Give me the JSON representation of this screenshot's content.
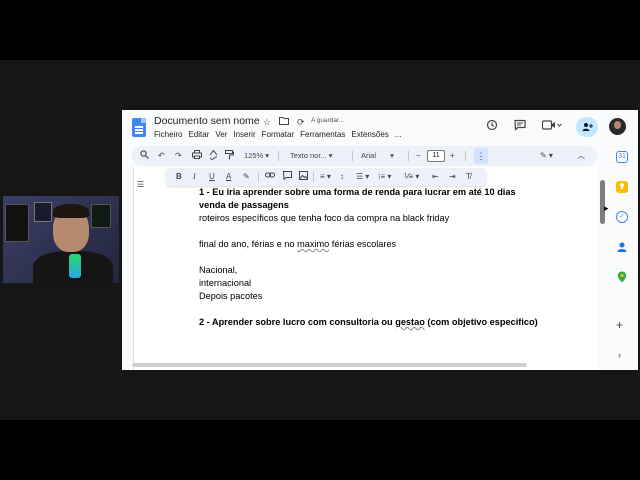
{
  "window": {
    "doc_title": "Documento sem nome",
    "save_status": "A guardar...",
    "menus": [
      "Ficheiro",
      "Editar",
      "Ver",
      "Inserir",
      "Formatar",
      "Ferramentas",
      "Extensões",
      "..."
    ]
  },
  "toolbar": {
    "zoom": "125%",
    "style": "Texto nor...",
    "font": "Arial",
    "font_size": "11",
    "minus": "−",
    "plus": "+"
  },
  "document": {
    "lines": [
      "1 - Eu iria aprender sobre uma forma de renda para lucrar em até 10 dias",
      "venda de passagens",
      "roteiros específicos que tenha foco da compra na black friday",
      "final do ano, férias e no ",
      "maximo",
      " férias escolares",
      "Nacional,",
      "internacional",
      "Depois pacotes",
      "2 - Aprender sobre lucro com consultoria ou ",
      "gestao",
      " (com objetivo especifico)"
    ]
  },
  "colors": {
    "accent": "#4285f4",
    "share_button": "#c2e7ff",
    "toolbar_bg": "#edf2fa",
    "keep": "#fbbc04",
    "tasks": "#4285f4",
    "contacts": "#1a73e8",
    "maps": "#34a853"
  },
  "icons": {
    "doc": "docs-logo-icon",
    "star": "star-icon",
    "folder": "folder-icon",
    "sync": "sync-icon",
    "history": "history-icon",
    "comment": "comment-icon",
    "video": "video-icon",
    "share": "share-icon"
  }
}
